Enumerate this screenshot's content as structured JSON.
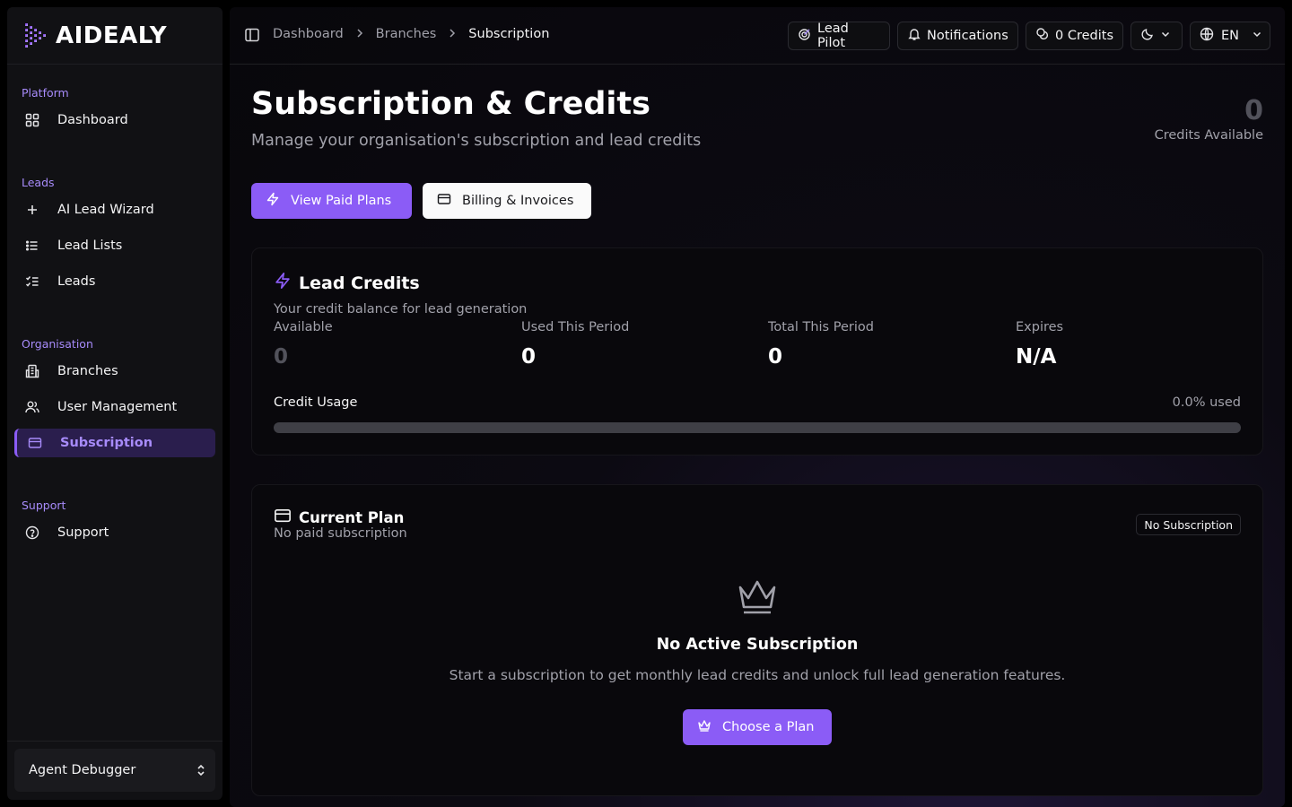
{
  "brand": {
    "name": "AIDEALY"
  },
  "sidebar": {
    "groups": [
      {
        "label": "Platform",
        "items": [
          {
            "label": "Dashboard",
            "icon": "dashboard-grid-icon"
          }
        ]
      },
      {
        "label": "Leads",
        "items": [
          {
            "label": "AI Lead Wizard",
            "icon": "plus-icon"
          },
          {
            "label": "Lead Lists",
            "icon": "list-icon"
          },
          {
            "label": "Leads",
            "icon": "checklist-icon"
          }
        ]
      },
      {
        "label": "Organisation",
        "items": [
          {
            "label": "Branches",
            "icon": "building-icon"
          },
          {
            "label": "User Management",
            "icon": "users-icon"
          },
          {
            "label": "Subscription",
            "icon": "credit-card-icon",
            "active": true
          }
        ]
      },
      {
        "label": "Support",
        "items": [
          {
            "label": "Support",
            "icon": "help-circle-icon"
          }
        ]
      }
    ],
    "footer": {
      "label": "Agent Debugger"
    }
  },
  "topbar": {
    "breadcrumb": [
      "Dashboard",
      "Branches",
      "Subscription"
    ],
    "lead_pilot": "Lead Pilot",
    "notifications": "Notifications",
    "credits": "0 Credits",
    "language": "EN"
  },
  "page": {
    "title": "Subscription & Credits",
    "subtitle": "Manage your organisation's subscription and lead credits",
    "credits_available_value": "0",
    "credits_available_label": "Credits Available",
    "view_plans": "View Paid Plans",
    "billing": "Billing & Invoices"
  },
  "lead_credits": {
    "title": "Lead Credits",
    "subtitle": "Your credit balance for lead generation",
    "stats": [
      {
        "label": "Available",
        "value": "0"
      },
      {
        "label": "Used This Period",
        "value": "0"
      },
      {
        "label": "Total This Period",
        "value": "0"
      },
      {
        "label": "Expires",
        "value": "N/A"
      }
    ],
    "usage_label": "Credit Usage",
    "usage_text": "0.0% used",
    "usage_fraction": 0.0
  },
  "current_plan": {
    "title": "Current Plan",
    "subtitle": "No paid subscription",
    "badge": "No Subscription",
    "empty_title": "No Active Subscription",
    "empty_text": "Start a subscription to get monthly lead credits and unlock full lead generation features.",
    "cta": "Choose a Plan"
  },
  "colors": {
    "accent": "#8b5cf6",
    "accent_text": "#a78bfa",
    "background": "#000000"
  }
}
